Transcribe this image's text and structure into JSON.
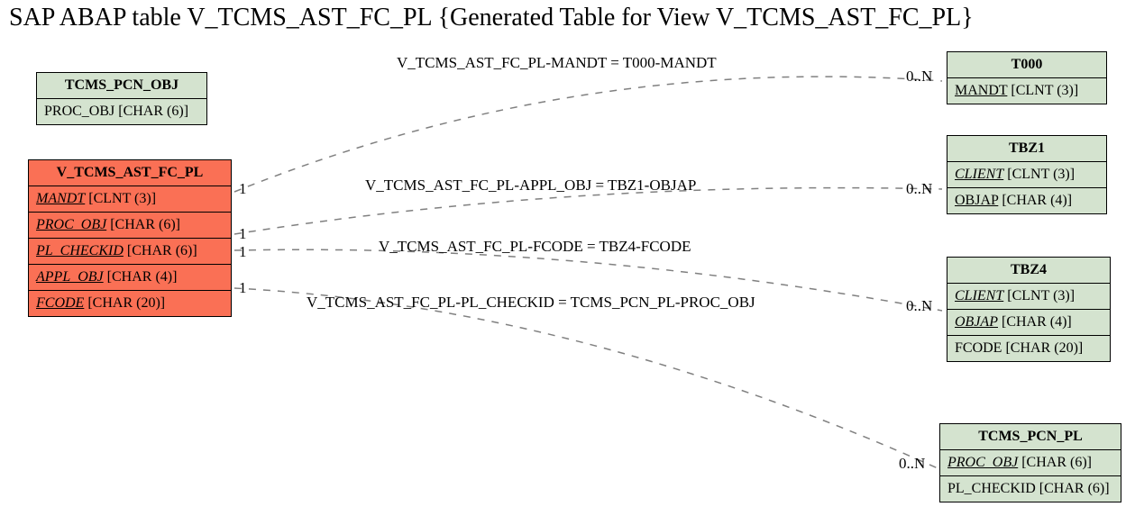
{
  "title": "SAP ABAP table V_TCMS_AST_FC_PL {Generated Table for View V_TCMS_AST_FC_PL}",
  "entities": {
    "tcms_pcn_obj": {
      "name": "TCMS_PCN_OBJ",
      "rows": [
        {
          "label": "PROC_OBJ",
          "type": "[CHAR (6)]",
          "key": false
        }
      ]
    },
    "main": {
      "name": "V_TCMS_AST_FC_PL",
      "rows": [
        {
          "label": "MANDT",
          "type": "[CLNT (3)]",
          "key": true
        },
        {
          "label": "PROC_OBJ",
          "type": "[CHAR (6)]",
          "key": true
        },
        {
          "label": "PL_CHECKID",
          "type": "[CHAR (6)]",
          "key": true
        },
        {
          "label": "APPL_OBJ",
          "type": "[CHAR (4)]",
          "key": true
        },
        {
          "label": "FCODE",
          "type": "[CHAR (20)]",
          "key": true
        }
      ]
    },
    "t000": {
      "name": "T000",
      "rows": [
        {
          "label": "MANDT",
          "type": "[CLNT (3)]",
          "key": false,
          "underline": true
        }
      ]
    },
    "tbz1": {
      "name": "TBZ1",
      "rows": [
        {
          "label": "CLIENT",
          "type": "[CLNT (3)]",
          "key": true
        },
        {
          "label": "OBJAP",
          "type": "[CHAR (4)]",
          "key": false,
          "underline": true
        }
      ]
    },
    "tbz4": {
      "name": "TBZ4",
      "rows": [
        {
          "label": "CLIENT",
          "type": "[CLNT (3)]",
          "key": true
        },
        {
          "label": "OBJAP",
          "type": "[CHAR (4)]",
          "key": true
        },
        {
          "label": "FCODE",
          "type": "[CHAR (20)]",
          "key": false
        }
      ]
    },
    "tcms_pcn_pl": {
      "name": "TCMS_PCN_PL",
      "rows": [
        {
          "label": "PROC_OBJ",
          "type": "[CHAR (6)]",
          "key": true
        },
        {
          "label": "PL_CHECKID",
          "type": "[CHAR (6)]",
          "key": false
        }
      ]
    }
  },
  "relations": {
    "r1": {
      "text": "V_TCMS_AST_FC_PL-MANDT = T000-MANDT",
      "left": "1",
      "right": "0..N"
    },
    "r2": {
      "text": "V_TCMS_AST_FC_PL-APPL_OBJ = TBZ1-OBJAP",
      "left": "1",
      "right": "0..N"
    },
    "r3": {
      "text": "V_TCMS_AST_FC_PL-FCODE = TBZ4-FCODE",
      "left": "1",
      "right": "0..N"
    },
    "r4": {
      "text": "V_TCMS_AST_FC_PL-PL_CHECKID = TCMS_PCN_PL-PROC_OBJ",
      "left": "1",
      "right": "0..N"
    }
  }
}
